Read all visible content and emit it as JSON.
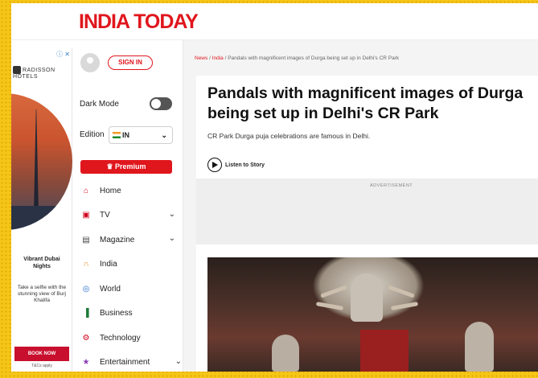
{
  "site": {
    "logo": "INDIA TODAY"
  },
  "ad": {
    "close": "ⓘ ✕",
    "brand": "RADISSON HOTELS",
    "headline": "Vibrant Dubai Nights",
    "body": "Take a selfie with the stunning view of Burj Khalifa",
    "cta": "BOOK NOW",
    "terms": "T&Cs apply"
  },
  "sidebar": {
    "signin": "SIGN IN",
    "dark_mode_label": "Dark Mode",
    "edition_label": "Edition",
    "edition_value": "IN",
    "premium": "♛ Premium",
    "nav": [
      {
        "label": "Home",
        "icon": "home-icon",
        "glyph": "⌂",
        "chevron": false
      },
      {
        "label": "TV",
        "icon": "tv-icon",
        "glyph": "▣",
        "chevron": true
      },
      {
        "label": "Magazine",
        "icon": "magazine-icon",
        "glyph": "▤",
        "chevron": true
      },
      {
        "label": "India",
        "icon": "india-icon",
        "glyph": "∩",
        "chevron": false
      },
      {
        "label": "World",
        "icon": "globe-icon",
        "glyph": "◎",
        "chevron": false
      },
      {
        "label": "Business",
        "icon": "business-chart-icon",
        "glyph": "▐",
        "chevron": false
      },
      {
        "label": "Technology",
        "icon": "technology-icon",
        "glyph": "⚙",
        "chevron": false
      },
      {
        "label": "Entertainment",
        "icon": "entertainment-icon",
        "glyph": "★",
        "chevron": true
      }
    ]
  },
  "article": {
    "breadcrumb_news": "News",
    "breadcrumb_india": "India",
    "breadcrumb_current": "Pandals with magnificent images of Durga being set up in Delhi's CR Park",
    "headline": "Pandals with magnificent images of Durga being set up in Delhi's CR Park",
    "subhead": "CR Park Durga puja celebrations are famous in Delhi.",
    "listen": "Listen to Story",
    "ad_label": "ADVERTISEMENT"
  },
  "colors": {
    "brand_red": "#e0161d",
    "frame": "#f5c518"
  }
}
